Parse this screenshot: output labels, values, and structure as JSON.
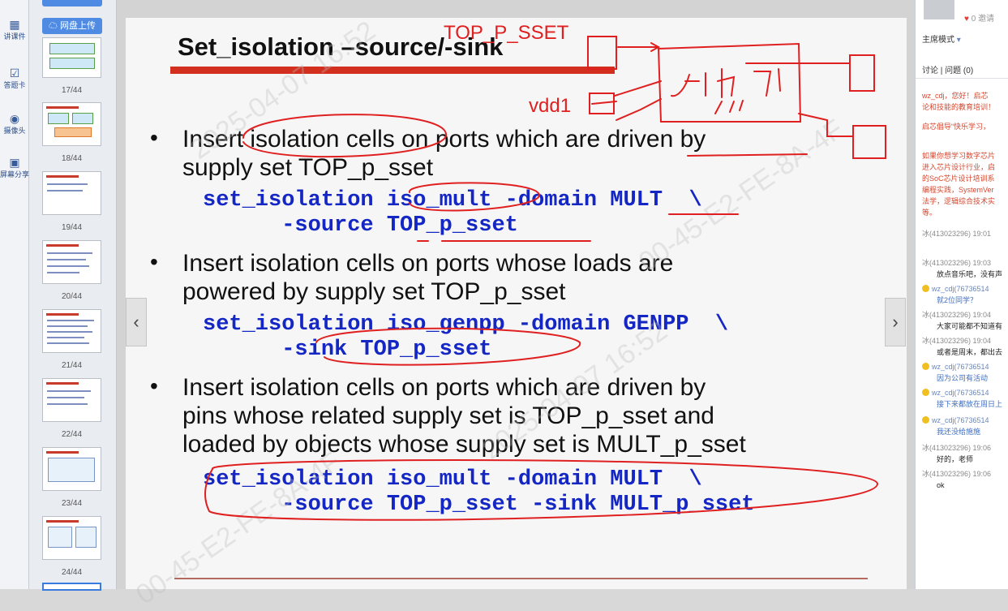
{
  "toolbar": {
    "items": [
      {
        "icon": "courseware-icon",
        "label": "讲课件"
      },
      {
        "icon": "answer-card-icon",
        "label": "答题卡"
      },
      {
        "icon": "camera-icon",
        "label": "摄像头"
      },
      {
        "icon": "screen-share-icon",
        "label": "屏幕分享"
      }
    ]
  },
  "thumbs": {
    "upload_label": "网盘上传",
    "pages": [
      "17/44",
      "18/44",
      "19/44",
      "20/44",
      "21/44",
      "22/44",
      "23/44",
      "24/44"
    ]
  },
  "slide": {
    "title": "Set_isolation –source/-sink",
    "bullets": [
      {
        "text": [
          "Insert isolation cells on ports which are driven by",
          "supply set TOP_p_sset"
        ],
        "code": [
          "set_isolation iso_mult -domain MULT  \\",
          "      -source TOP_p_sset"
        ]
      },
      {
        "text": [
          "Insert isolation cells on ports whose loads are",
          "powered by supply set TOP_p_sset"
        ],
        "code": [
          "set_isolation iso_genpp -domain GENPP  \\",
          "      -sink TOP_p_sset"
        ]
      },
      {
        "text": [
          "Insert isolation cells on ports which are driven by",
          "pins whose related supply set is TOP_p_sset and",
          "loaded by objects whose supply set is MULT_p_sset"
        ],
        "code": [
          "set_isolation iso_mult -domain MULT  \\",
          "      -source TOP_p_sset -sink MULT_p_sset"
        ]
      }
    ],
    "annotations": [
      "TOP_P_SSET",
      "vdd1",
      "MULT"
    ],
    "watermarks": [
      "2025-04-07 16:52",
      "00-45-E2-FE-8A-4F"
    ]
  },
  "navigation": {
    "prev_label": "‹",
    "next_label": "›"
  },
  "chat": {
    "likes": "0",
    "likes_suffix": "邀请",
    "mode": "主席模式",
    "tabs": "讨论 | 问题 (0)",
    "messages": [
      {
        "kind": "sys",
        "text": "wz_cdj，您好！启芯"
      },
      {
        "kind": "sys",
        "text": "论和技能的教育培训！"
      },
      {
        "kind": "sys",
        "text": "启芯倡导“快乐学习，"
      },
      {
        "kind": "sys",
        "text": "如果你想学习数字芯片"
      },
      {
        "kind": "sys",
        "text": "进入芯片设计行业，启"
      },
      {
        "kind": "sys",
        "text": "的SoC芯片设计培训系"
      },
      {
        "kind": "sys",
        "text": "编程实践，SystemVer"
      },
      {
        "kind": "sys",
        "text": "法学，逻辑综合技术实"
      },
      {
        "kind": "sys",
        "text": "等。"
      },
      {
        "kind": "who",
        "text": "冰(413023296) 19:01"
      },
      {
        "kind": "who",
        "text": "冰(413023296) 19:03"
      },
      {
        "kind": "txt",
        "text": "放点音乐吧，没有声"
      },
      {
        "kind": "who2",
        "text": "wz_cdj(76736514"
      },
      {
        "kind": "txt2",
        "text": "就2位同学？"
      },
      {
        "kind": "who",
        "text": "冰(413023296) 19:04"
      },
      {
        "kind": "txt",
        "text": "大家可能都不知道有"
      },
      {
        "kind": "who",
        "text": "冰(413023296) 19:04"
      },
      {
        "kind": "txt",
        "text": "或者是周末，都出去"
      },
      {
        "kind": "who2",
        "text": "wz_cdj(76736514"
      },
      {
        "kind": "txt2",
        "text": "因为公司有活动"
      },
      {
        "kind": "who2",
        "text": "wz_cdj(76736514"
      },
      {
        "kind": "txt2",
        "text": "接下来都放在周日上"
      },
      {
        "kind": "who2",
        "text": "wz_cdj(76736514"
      },
      {
        "kind": "txt2",
        "text": "我还没给施施"
      },
      {
        "kind": "who",
        "text": "冰(413023296) 19:06"
      },
      {
        "kind": "txt",
        "text": "好的，老师"
      },
      {
        "kind": "who",
        "text": "冰(413023296) 19:06"
      },
      {
        "kind": "txt",
        "text": "ok"
      }
    ]
  }
}
